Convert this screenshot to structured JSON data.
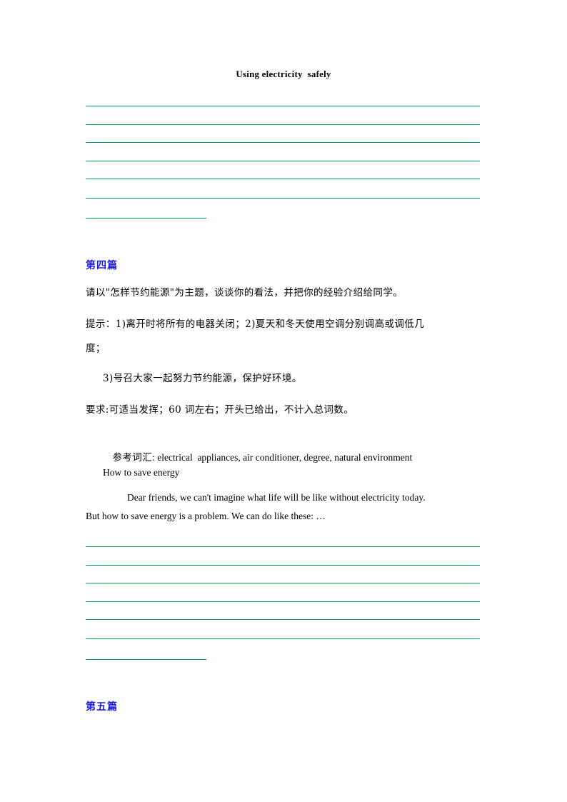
{
  "document": {
    "title": "Using electricity  safely",
    "colors": {
      "rule_green": "#00A14F",
      "heading_blue": "#1A1AE0",
      "body_black": "#000000"
    }
  },
  "answer_block_top": {
    "name": "ruled-answer-area-top",
    "full_line_count": 6,
    "short_line_count": 1
  },
  "section_four": {
    "heading": "第四篇",
    "prompt": "请以\"怎样节约能源\"为主题，谈谈你的看法，并把你的经验介绍给同学。",
    "hints_line1": "提示：1)离开时将所有的电器关闭；2)夏天和冬天使用空调分别调高或调低几",
    "hints_line2": "度；",
    "hints_line3": "3)号召大家一起努力节约能源，保护好环境。",
    "requirements": "要求:可适当发挥；60 词左右；开头已给出，不计入总词数。",
    "vocabulary_label": "参考词汇",
    "vocabulary_value": ": electrical  appliances, air conditioner, degree, natural environment",
    "essay_title": "How to save energy",
    "essay_line1": "Dear friends, we can't imagine what life will be like without electricity today.",
    "essay_line2": "But how to save energy is a problem. We can do like these: …"
  },
  "answer_block_bottom": {
    "name": "ruled-answer-area-bottom",
    "full_line_count": 6,
    "short_line_count": 1
  },
  "section_five": {
    "heading": "第五篇"
  }
}
